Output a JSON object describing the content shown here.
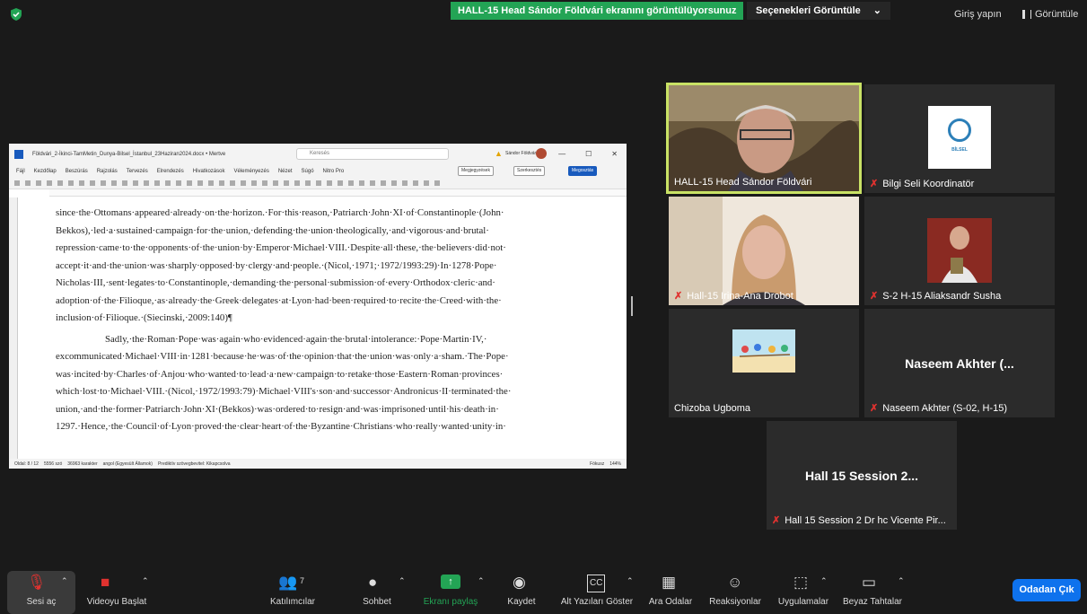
{
  "top": {
    "share_banner": "HALL-15 Head Sándor Földvári ekranını görüntülüyorsunuz",
    "view_options": "Seçenekleri Görüntüle",
    "view_options_caret": "⌄",
    "signin": "Giriş yapın",
    "view_label": "Görüntüle"
  },
  "doc": {
    "filename": "Földvári_2-İkinci-TamMetin_Dunya-Bilsel_İstanbul_23Haziran2024.docx • Mertve",
    "search_placeholder": "Keresés",
    "user": "Sándor Földvári",
    "ribbon_tabs": [
      "Fájl",
      "Kezdőlap",
      "Beszúrás",
      "Rajzolás",
      "Tervezés",
      "Elrendezés",
      "Hivatkozások",
      "Véleményezés",
      "Nézet",
      "Súgó",
      "Nitro Pro"
    ],
    "btn_comments": "Megjegyzések",
    "btn_edit": "Szerkesztés",
    "btn_share": "Megosztás",
    "paragraph1": [
      "since·the·Ottomans·appeared·already·on·the·horizon.·For·this·reason,·Patriarch·John·XI·of·Constantinople·(John·",
      "Bekkos),·led·a·sustained·campaign·for·the·union,·defending·the·union·theologically,·and·vigorous·and·brutal·",
      "repression·came·to·the·opponents·of·the·union·by·Emperor·Michael·VIII.·Despite·all·these,·the·believers·did·not·",
      "accept·it·and·the·union·was·sharply·opposed·by·clergy·and·people.·(Nicol,·1971;·1972/1993:29)·In·1278·Pope·",
      "Nicholas·III,·sent·legates·to·Constantinople,·demanding·the·personal·submission·of·every·Orthodox·cleric·and·",
      "adoption·of·the·Filioque,·as·already·the·Greek·delegates·at·Lyon·had·been·required·to·recite·the·Creed·with·the·",
      "inclusion·of·Filioque.·(Siecinski,·2009:140)¶"
    ],
    "paragraph2": [
      "Sadly,·the·Roman·Pope·was·again·who·evidenced·again·the·brutal·intolerance:·Pope·Martin·IV,·",
      "excommunicated·Michael·VIII·in·1281·because·he·was·of·the·opinion·that·the·union·was·only·a·sham.·The·Pope·",
      "was·incited·by·Charles·of·Anjou·who·wanted·to·lead·a·new·campaign·to·retake·those·Eastern·Roman·provinces·",
      "which·lost·to·Michael·VIII.·(Nicol,·1972/1993:79)·Michael·VIII's·son·and·successor·Andronicus·II·terminated·the·",
      "union,·and·the·former·Patriarch·John·XI·(Bekkos)·was·ordered·to·resign·and·was·imprisoned·until·his·death·in·",
      "1297.·Hence,·the·Council·of·Lyon·proved·the·clear·heart·of·the·Byzantine·Christians·who·really·wanted·unity·in·"
    ],
    "status_page": "Oldal: 8 / 12",
    "status_words": "5556 szó",
    "status_chars": "36963 karakter",
    "status_lang": "angol (Egyesült Államok)",
    "status_predict": "Prediktív szövegbevitel: Kikapcsolva",
    "status_focus": "Fókusz",
    "status_zoom": "144%"
  },
  "tiles": [
    {
      "name": "HALL-15 Head Sándor Földvári",
      "muted": false,
      "active": true
    },
    {
      "name": "Bilgi Seli Koordinatör",
      "muted": true
    },
    {
      "name": "Hall-15 Irina-Ana Drobot",
      "muted": true
    },
    {
      "name": "S-2 H-15 Aliaksandr Susha",
      "muted": true
    },
    {
      "name": "Chizoba Ugboma",
      "muted": false
    },
    {
      "name": "Naseem Akhter (S-02, H-15)",
      "muted": true,
      "big": "Naseem Akhter (..."
    },
    {
      "name": "Hall 15 Session 2 Dr hc Vicente Pir...",
      "muted": true,
      "big": "Hall 15 Session 2..."
    }
  ],
  "logo_text": "BİLSEL",
  "controls": {
    "unmute": "Sesi aç",
    "start_video": "Videoyu Başlat",
    "participants": "Katılımcılar",
    "participants_count": "7",
    "chat": "Sohbet",
    "share_screen": "Ekranı paylaş",
    "record": "Kaydet",
    "captions": "Alt Yazıları Göster",
    "breakout": "Ara Odalar",
    "reactions": "Reaksiyonlar",
    "apps": "Uygulamalar",
    "whiteboards": "Beyaz Tahtalar",
    "leave": "Odadan Çık"
  }
}
